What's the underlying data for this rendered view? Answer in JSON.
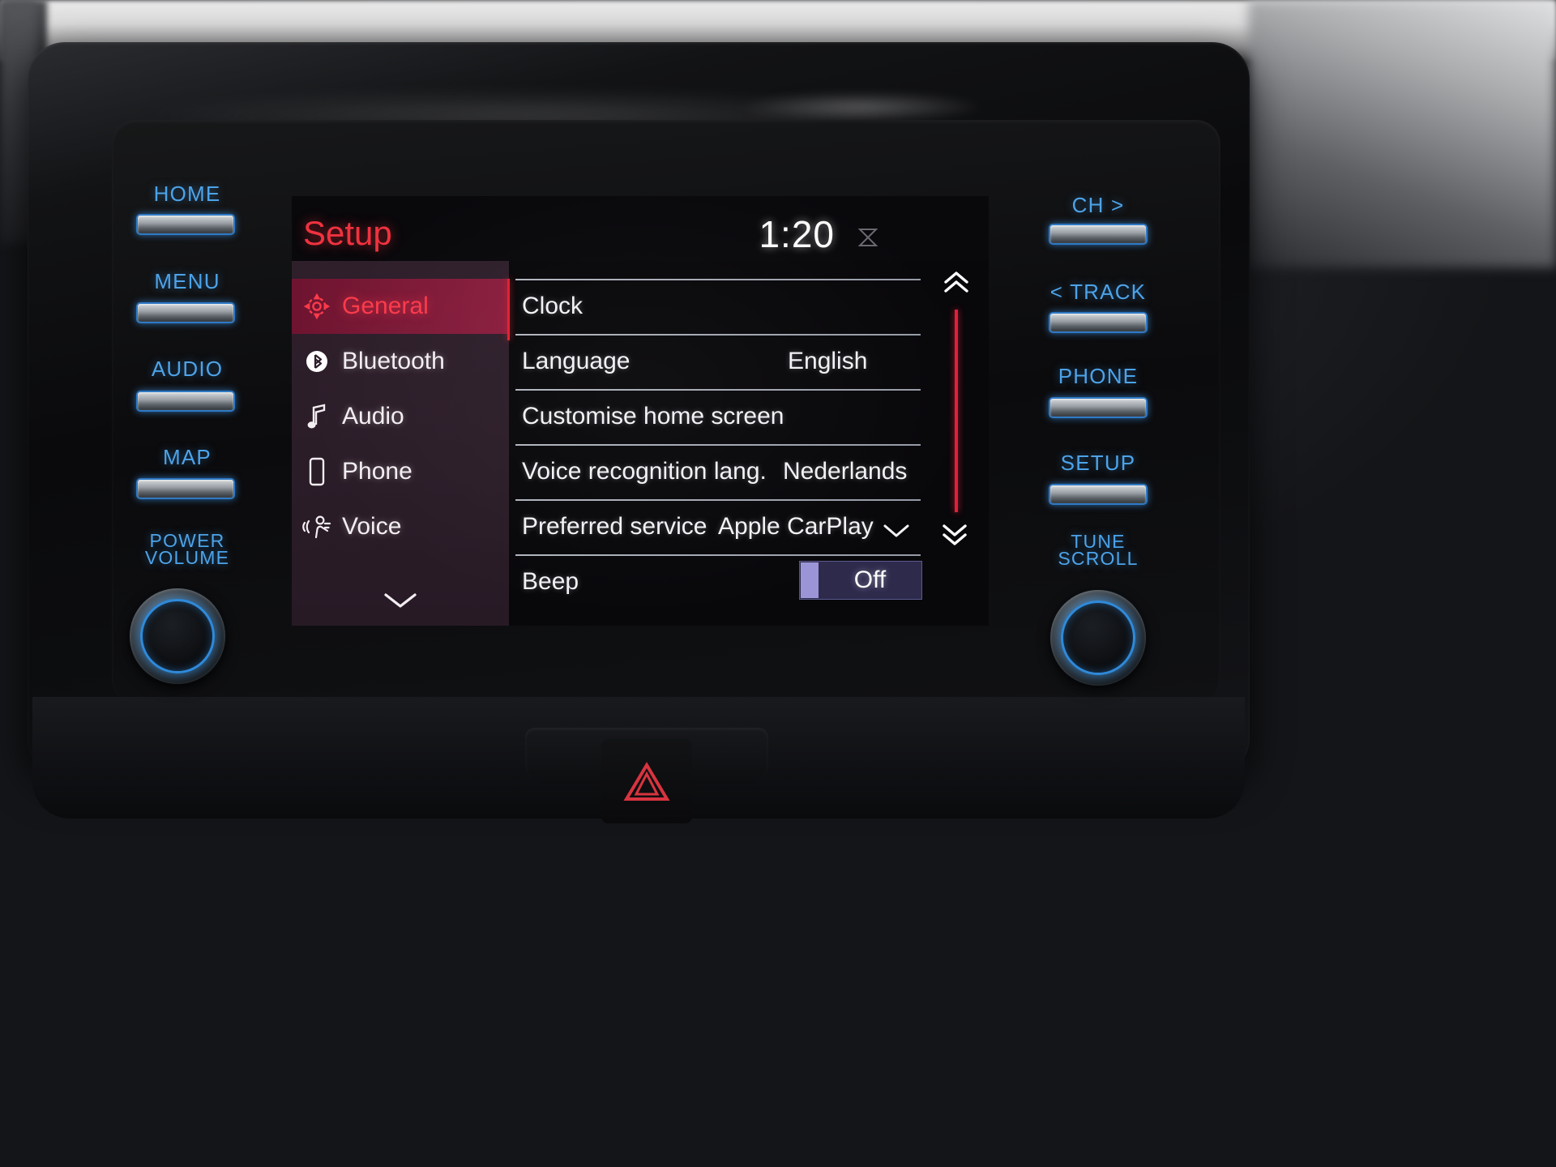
{
  "screen": {
    "header": {
      "title": "Setup",
      "clock": "1:20",
      "status_icon": "no-signal-icon"
    },
    "sidebar": {
      "items": [
        {
          "label": "General",
          "icon": "gear-icon",
          "selected": true
        },
        {
          "label": "Bluetooth",
          "icon": "bluetooth-icon",
          "selected": false
        },
        {
          "label": "Audio",
          "icon": "music-note-icon",
          "selected": false
        },
        {
          "label": "Phone",
          "icon": "phone-icon",
          "selected": false
        },
        {
          "label": "Voice",
          "icon": "voice-icon",
          "selected": false
        }
      ],
      "more_icon": "chevron-down-icon"
    },
    "list": {
      "rows": [
        {
          "label": "Clock",
          "value": "",
          "control": "none"
        },
        {
          "label": "Language",
          "value": "English",
          "control": "none"
        },
        {
          "label": "Customise home screen",
          "value": "",
          "control": "none"
        },
        {
          "label": "Voice recognition lang.",
          "value": "Nederlands",
          "control": "none"
        },
        {
          "label": "Preferred service",
          "value": "Apple CarPlay",
          "control": "dropdown"
        },
        {
          "label": "Beep",
          "value": "Off",
          "control": "toggle"
        }
      ]
    },
    "scroll": {
      "up_icon": "double-chevron-up-icon",
      "down_icon": "double-chevron-down-icon"
    },
    "colors": {
      "accent_red": "#f0323f",
      "selected_bg": "#7d1a38",
      "sidebar_bg": "#2b1d28",
      "toggle_knob": "#9b95d8"
    }
  },
  "bezel": {
    "left_buttons": [
      "HOME",
      "MENU",
      "AUDIO",
      "MAP"
    ],
    "right_buttons": [
      "CH  >",
      "< TRACK",
      "PHONE",
      "SETUP"
    ],
    "left_knob_label_line1": "POWER",
    "left_knob_label_line2": "VOLUME",
    "right_knob_label_line1": "TUNE",
    "right_knob_label_line2": "SCROLL",
    "hazard_icon": "hazard-triangle-icon"
  }
}
